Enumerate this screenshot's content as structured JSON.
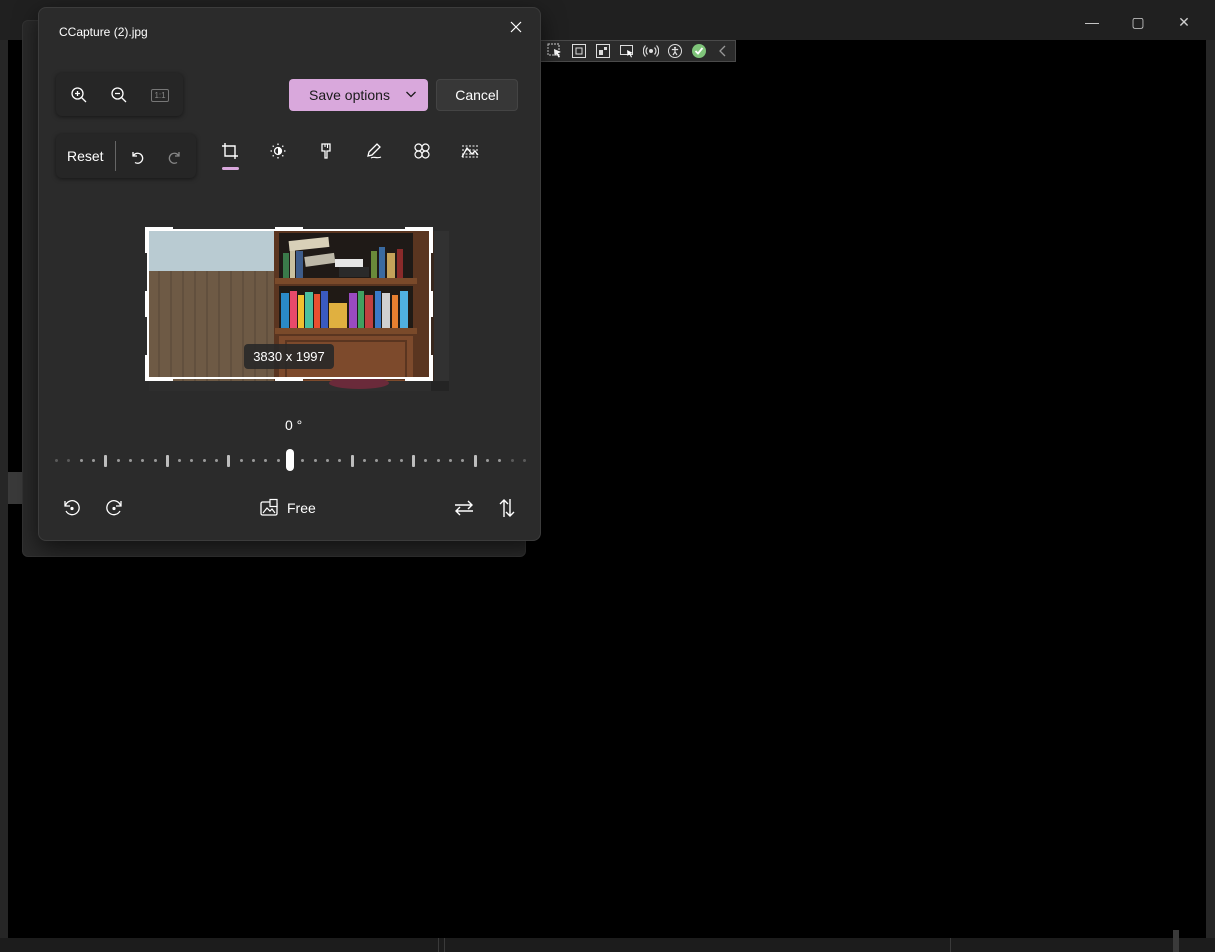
{
  "dialog": {
    "title": "CCapture (2).jpg",
    "save_label": "Save options",
    "cancel_label": "Cancel",
    "reset_label": "Reset",
    "zoom_actual_label": "1:1",
    "dimensions": "3830 x 1997",
    "rotation_angle": "0 °",
    "aspect_label": "Free",
    "active_tool": "crop"
  },
  "icons": {
    "close": "close-icon",
    "zoom_in": "zoom-in-icon",
    "zoom_out": "zoom-out-icon",
    "actual_size": "actual-size-icon",
    "undo": "undo-icon",
    "redo": "redo-icon",
    "crop": "crop-icon",
    "adjust": "brightness-icon",
    "filter": "filter-icon",
    "markup": "pen-icon",
    "retouch": "retouch-icon",
    "background": "background-blur-icon",
    "rotate_left": "rotate-left-icon",
    "rotate_right": "rotate-right-icon",
    "aspect": "aspect-ratio-icon",
    "flip_h": "flip-horizontal-icon",
    "flip_v": "flip-vertical-icon"
  },
  "colors": {
    "accent": "#d9a8dc",
    "dialog_bg": "#2b2b2b",
    "canvas_bg": "#000000"
  }
}
